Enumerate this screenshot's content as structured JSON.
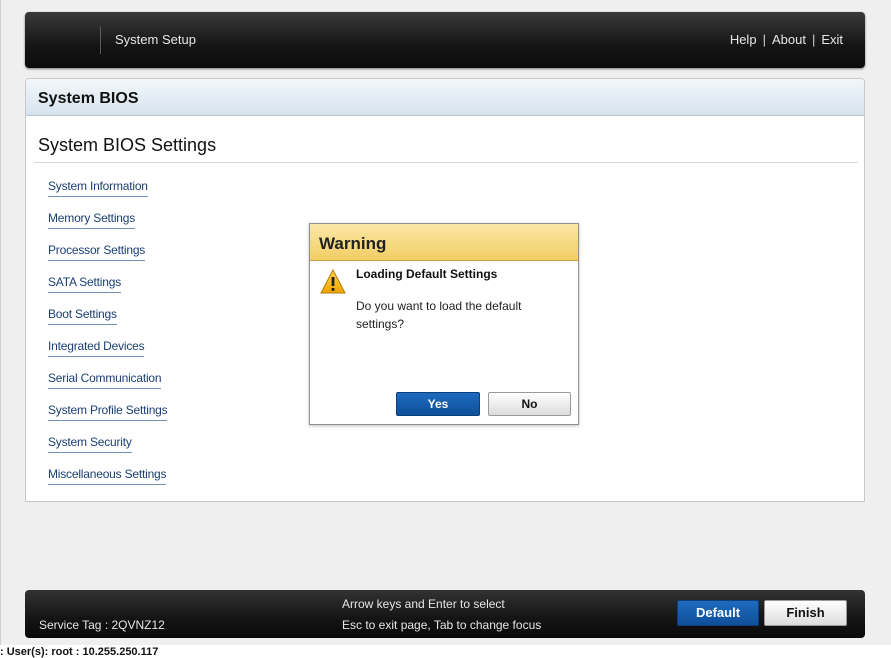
{
  "header": {
    "title": "System Setup",
    "links": [
      "Help",
      "About",
      "Exit"
    ],
    "separator": "|"
  },
  "panel": {
    "title": "System BIOS",
    "section_title": "System BIOS Settings",
    "menu": [
      "System Information",
      "Memory Settings",
      "Processor Settings",
      "SATA Settings",
      "Boot Settings",
      "Integrated Devices",
      "Serial Communication",
      "System Profile Settings",
      "System Security",
      "Miscellaneous Settings"
    ]
  },
  "dialog": {
    "title": "Warning",
    "icon": "warning-triangle-icon",
    "heading": "Loading Default Settings",
    "message": "Do you want to load the default settings?",
    "yes_label": "Yes",
    "no_label": "No"
  },
  "footer": {
    "service_tag": "Service Tag : 2QVNZ12",
    "help_line1": "Arrow keys and Enter to select",
    "help_line2": "Esc to exit page, Tab to change focus",
    "default_label": "Default",
    "finish_label": "Finish"
  },
  "status": {
    "text": ": User(s): root : 10.255.250.117"
  },
  "colors": {
    "accent_blue": "#1565b5",
    "warning_header": "#f2cd63",
    "link_blue": "#1a3f73"
  }
}
